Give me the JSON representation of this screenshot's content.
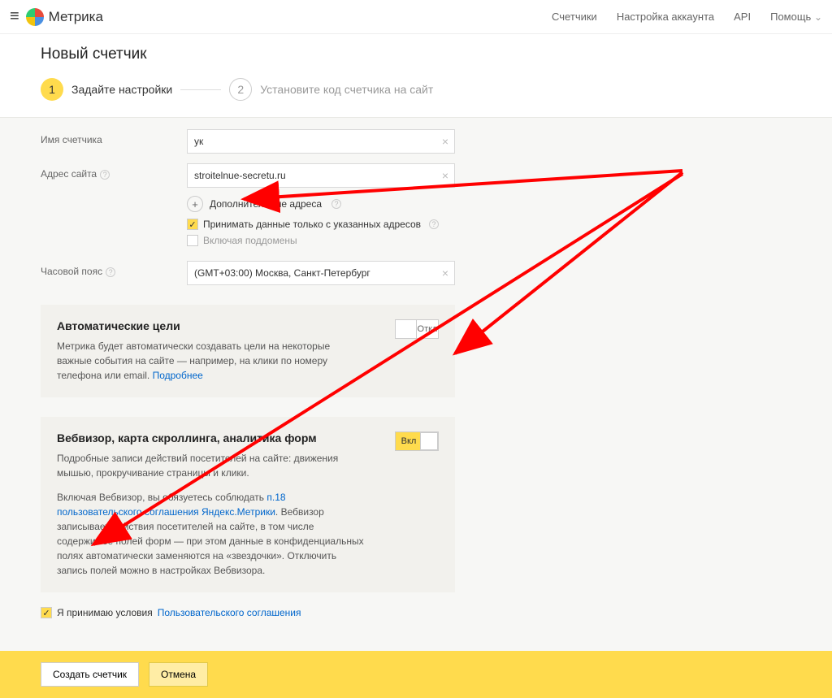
{
  "brand": "Метрика",
  "topnav": {
    "counters": "Счетчики",
    "account": "Настройка аккаунта",
    "api": "API",
    "help": "Помощь"
  },
  "page_title": "Новый счетчик",
  "stepper": {
    "step1_num": "1",
    "step1_label": "Задайте настройки",
    "step2_num": "2",
    "step2_label": "Установите код счетчика на сайт"
  },
  "labels": {
    "counter_name": "Имя счетчика",
    "site_address": "Адрес сайта",
    "timezone": "Часовой пояс",
    "additional_addresses": "Дополнительные адреса",
    "accept_only": "Принимать данные только с указанных адресов",
    "include_subdomains": "Включая поддомены"
  },
  "values": {
    "counter_name": "ук",
    "site_address": "stroitelnue-secretu.ru",
    "timezone": "(GMT+03:00) Москва, Санкт-Петербург"
  },
  "cards": {
    "auto_goals": {
      "title": "Автоматические цели",
      "text": "Метрика будет автоматически создавать цели на некоторые важные события на сайте — например, на клики по номеру телефона или email. ",
      "link": "Подробнее",
      "toggle": "Откл"
    },
    "webvisor": {
      "title": "Вебвизор, карта скроллинга, аналитика форм",
      "text1": "Подробные записи действий посетителей на сайте: движения мышью, прокручивание страницы и клики.",
      "text2a": "Включая Вебвизор, вы обязуетесь соблюдать ",
      "link": "п.18 пользовательского соглашения Яндекс.Метрики",
      "text2b": ". Вебвизор записывает действия посетителей на сайте, в том числе содержимое полей форм — при этом данные в конфиденциальных полях автоматически заменяются на «звездочки». Отключить запись полей можно в настройках Вебвизора.",
      "toggle": "Вкл"
    }
  },
  "agree": {
    "text": "Я принимаю условия ",
    "link": "Пользовательского соглашения"
  },
  "footer": {
    "create": "Создать счетчик",
    "cancel": "Отмена"
  }
}
